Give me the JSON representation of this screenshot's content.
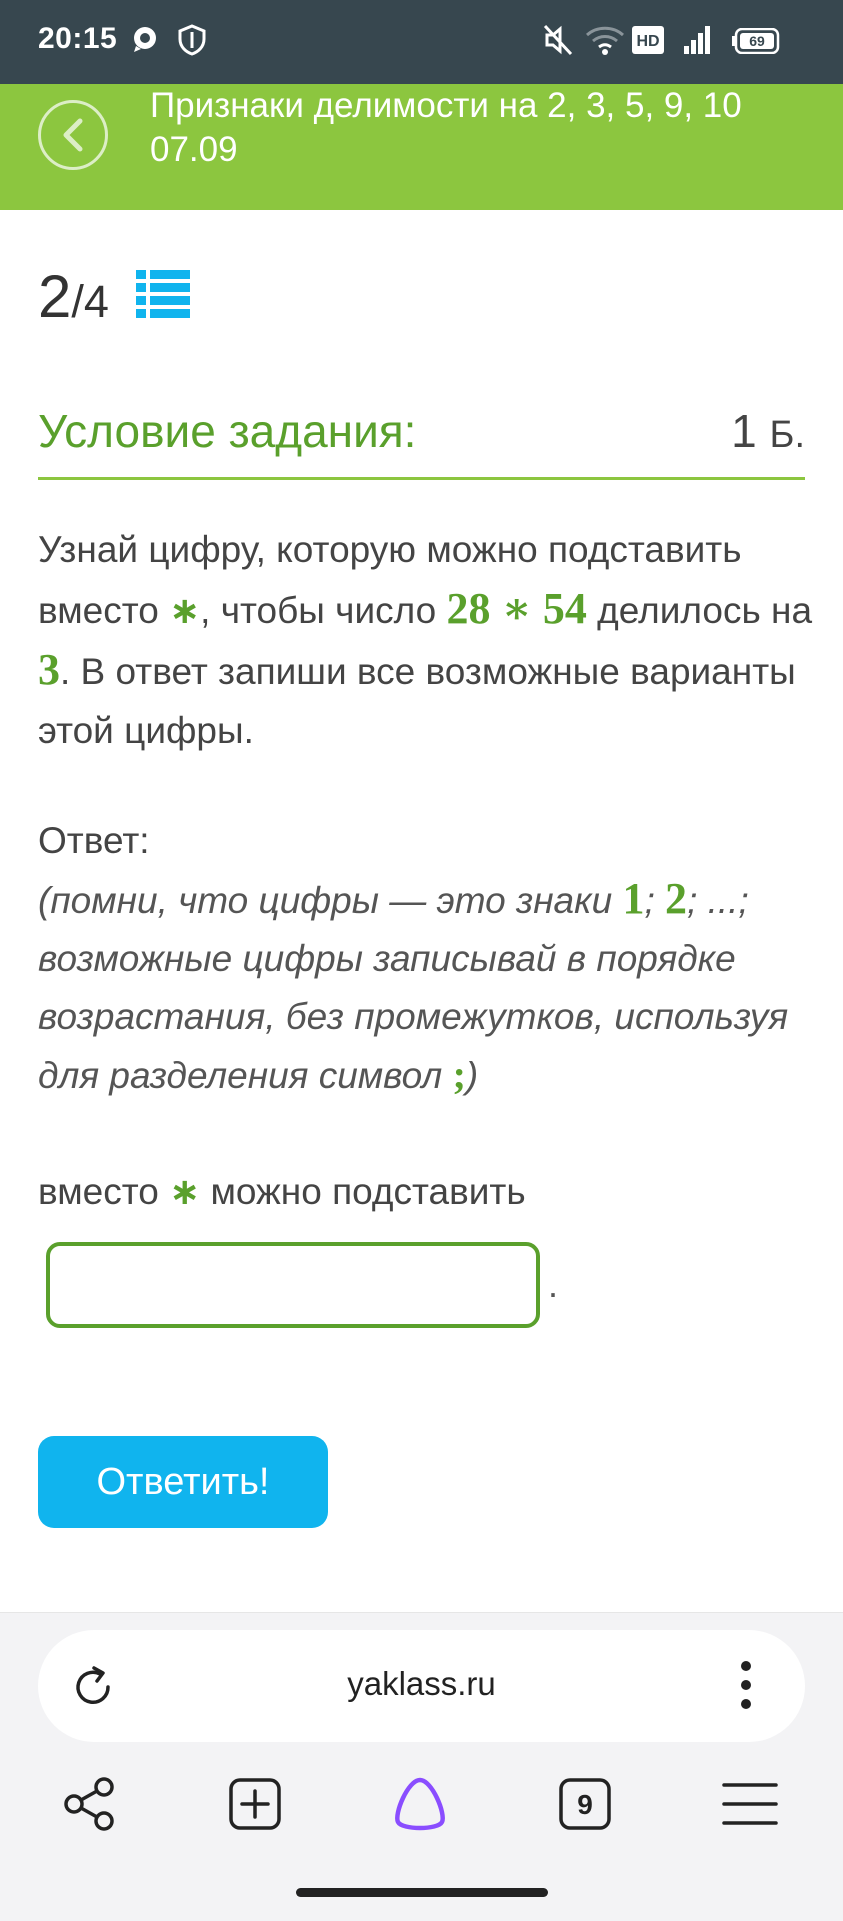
{
  "status_bar": {
    "time": "20:15",
    "icons": [
      "chat-bubble-icon",
      "shield-icon",
      "mute-icon",
      "wifi-icon",
      "hd-icon",
      "signal-icon",
      "battery-icon"
    ],
    "hd": "HD",
    "battery_level": "69"
  },
  "header": {
    "title_line1": "Признаки делимости на 2, 3, 5, 9, 10",
    "title_line2": "07.09",
    "bg_color": "#8cc63f"
  },
  "progress": {
    "current": "2",
    "separator": "/",
    "total": "4"
  },
  "task": {
    "title": "Условие задания:",
    "points": "1",
    "points_unit": "Б.",
    "text": {
      "p1": "Узнай цифру, которую можно подставить вместо ",
      "asterisk": "∗",
      "p2": ", чтобы число ",
      "number": "28 ∗ 54",
      "p3": " делилось на ",
      "divisor": "3",
      "p4": ". В ответ запиши все возможные варианты этой цифры."
    },
    "answer_label": "Ответ:",
    "hint": {
      "p1": "(помни, что цифры — это знаки ",
      "d1": "1",
      "sep1": "; ",
      "d2": "2",
      "p2": "; ...; возможные цифры записывай в порядке возрастания, без промежутков, используя для разделения символ ",
      "sym": ";",
      "p3": ")"
    },
    "fill": {
      "p1": "вместо ",
      "asterisk": "∗",
      "p2": " можно подставить"
    },
    "input_value": "",
    "input_suffix": ".",
    "submit_label": "Ответить!"
  },
  "browser": {
    "url": "yaklass.ru",
    "tab_count": "9",
    "nav_icons": [
      "share-icon",
      "new-tab-icon",
      "alice-icon",
      "tabs-icon",
      "hamburger-menu-icon"
    ]
  },
  "colors": {
    "accent_green": "#8cc63f",
    "text_green": "#5aa02c",
    "button_blue": "#10b4ee",
    "status_bar": "#37474f"
  }
}
